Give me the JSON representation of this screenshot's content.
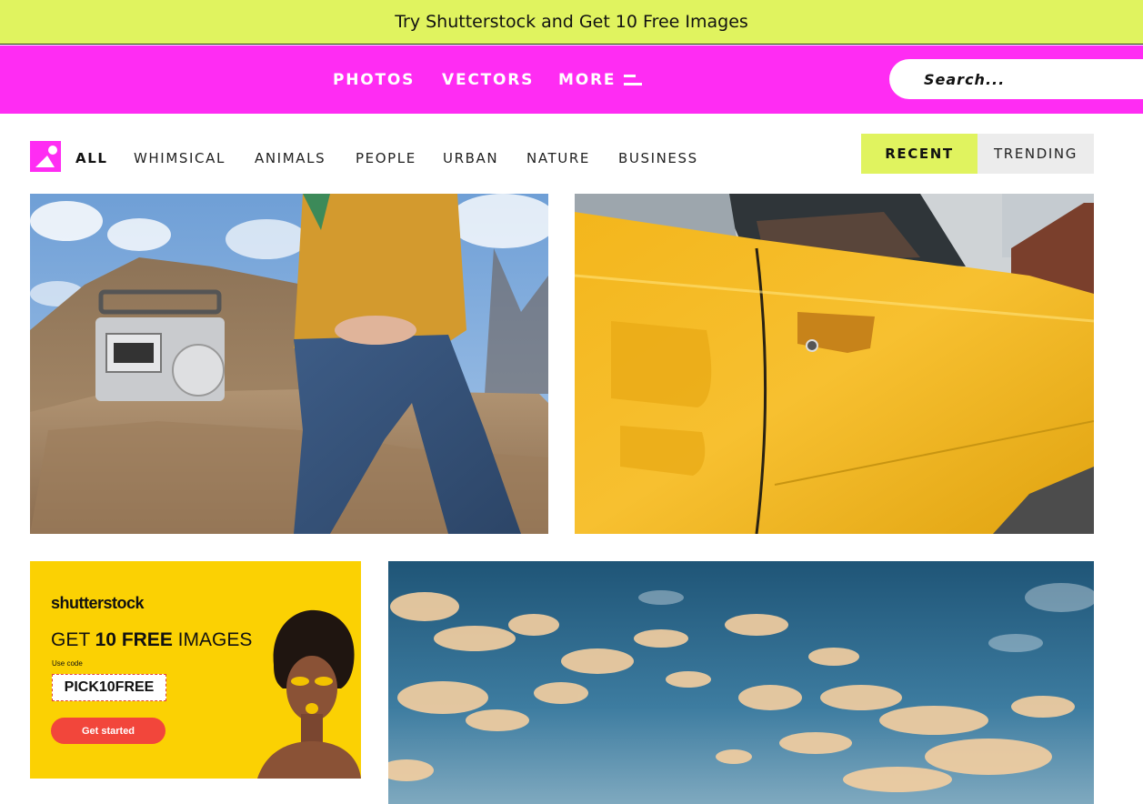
{
  "promo_banner": {
    "text": "Try Shutterstock and Get 10 Free Images"
  },
  "nav": {
    "links": [
      "PHOTOS",
      "VECTORS",
      "MORE"
    ],
    "menu_icon": "menu-lines-icon",
    "search": {
      "placeholder": "Search...",
      "value": ""
    }
  },
  "filters": {
    "logo_icon": "image-logo-icon",
    "categories": [
      "ALL",
      "WHIMSICAL",
      "ANIMALS",
      "PEOPLE",
      "URBAN",
      "NATURE",
      "BUSINESS"
    ],
    "active_category": "ALL",
    "sort": {
      "recent": "RECENT",
      "trending": "TRENDING",
      "active": "RECENT"
    }
  },
  "gallery": {
    "photos": [
      {
        "subject": "woman-with-radio-on-rocks"
      },
      {
        "subject": "yellow-car-door"
      },
      {
        "subject": "sky-with-clouds"
      }
    ],
    "ad": {
      "brand": "shutterstock",
      "headline_prefix": "GET ",
      "headline_bold": "10 FREE",
      "headline_suffix": " IMAGES",
      "code_label": "Use code",
      "code": "PICK10FREE",
      "cta": "Get started"
    }
  },
  "colors": {
    "promo_bg": "#e0f35f",
    "nav_bg": "#ff2cf3",
    "recent_bg": "#e0f35f",
    "trending_bg": "#ececec",
    "ad_bg": "#fbd103",
    "cta_bg": "#f2463b"
  }
}
